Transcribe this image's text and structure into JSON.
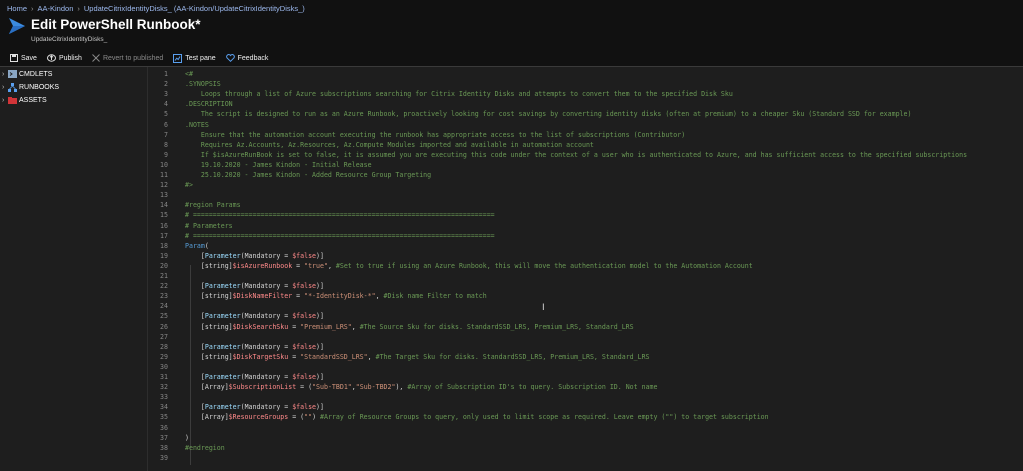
{
  "breadcrumb": [
    "Home",
    "AA-Kindon",
    "UpdateCitrixIdentityDisks_ (AA-Kindon/UpdateCitrixIdentityDisks_)"
  ],
  "title": "Edit PowerShell Runbook*",
  "subtitle": "UpdateCitrixIdentityDisks_",
  "toolbar": {
    "save": "Save",
    "publish": "Publish",
    "revert": "Revert to published",
    "test_pane": "Test pane",
    "feedback": "Feedback"
  },
  "sidebar": {
    "items": [
      {
        "label": "CMDLETS",
        "icon": "cmdlets-icon"
      },
      {
        "label": "RUNBOOKS",
        "icon": "runbooks-icon"
      },
      {
        "label": "ASSETS",
        "icon": "assets-icon"
      }
    ]
  },
  "code_lines": [
    {
      "n": "1",
      "tokens": [
        [
          "c",
          "<#"
        ]
      ]
    },
    {
      "n": "2",
      "tokens": [
        [
          "c",
          ".SYNOPSIS"
        ]
      ]
    },
    {
      "n": "3",
      "tokens": [
        [
          "c",
          "    Loops through a list of Azure subscriptions searching for Citrix Identity Disks and attempts to convert them to the specified Disk Sku"
        ]
      ]
    },
    {
      "n": "4",
      "tokens": [
        [
          "c",
          ".DESCRIPTION"
        ]
      ]
    },
    {
      "n": "5",
      "tokens": [
        [
          "c",
          "    The script is designed to run as an Azure Runbook, proactively looking for cost savings by converting identity disks (often at premium) to a cheaper Sku (Standard SSD for example)"
        ]
      ]
    },
    {
      "n": "6",
      "tokens": [
        [
          "c",
          ".NOTES"
        ]
      ]
    },
    {
      "n": "7",
      "tokens": [
        [
          "c",
          "    Ensure that the automation account executing the runbook has appropriate access to the list of subscriptions (Contributor)"
        ]
      ]
    },
    {
      "n": "8",
      "tokens": [
        [
          "c",
          "    Requires Az.Accounts, Az.Resources, Az.Compute Modules imported and available in automation account"
        ]
      ]
    },
    {
      "n": "9",
      "tokens": [
        [
          "c",
          "    If $isAzureRunBook is set to false, it is assumed you are executing this code under the context of a user who is authenticated to Azure, and has sufficient access to the specified subscriptions"
        ]
      ]
    },
    {
      "n": "10",
      "tokens": [
        [
          "c",
          "    19.10.2020 - James Kindon - Initial Release"
        ]
      ]
    },
    {
      "n": "11",
      "tokens": [
        [
          "c",
          "    25.10.2020 - James Kindon - Added Resource Group Targeting"
        ]
      ]
    },
    {
      "n": "12",
      "tokens": [
        [
          "c",
          "#>"
        ]
      ]
    },
    {
      "n": "13",
      "tokens": []
    },
    {
      "n": "14",
      "tokens": [
        [
          "c",
          "#region Params"
        ]
      ]
    },
    {
      "n": "15",
      "tokens": [
        [
          "c",
          "# ============================================================================"
        ]
      ]
    },
    {
      "n": "16",
      "tokens": [
        [
          "c",
          "# Parameters"
        ]
      ]
    },
    {
      "n": "17",
      "tokens": [
        [
          "c",
          "# ============================================================================"
        ]
      ]
    },
    {
      "n": "18",
      "tokens": [
        [
          "k",
          "Param"
        ],
        [
          "p",
          "("
        ]
      ]
    },
    {
      "n": "19",
      "tokens": [
        [
          "p",
          "    ["
        ],
        [
          "t",
          "Parameter"
        ],
        [
          "p",
          "(Mandatory = "
        ],
        [
          "v",
          "$false"
        ],
        [
          "p",
          ")]"
        ]
      ]
    },
    {
      "n": "20",
      "tokens": [
        [
          "p",
          "    [string]"
        ],
        [
          "v",
          "$isAzureRunbook"
        ],
        [
          "p",
          " = "
        ],
        [
          "s",
          "\"true\""
        ],
        [
          "p",
          ", "
        ],
        [
          "c",
          "#Set to true if using an Azure Runbook, this will move the authentication model to the Automation Account"
        ]
      ]
    },
    {
      "n": "21",
      "tokens": []
    },
    {
      "n": "22",
      "tokens": [
        [
          "p",
          "    ["
        ],
        [
          "t",
          "Parameter"
        ],
        [
          "p",
          "(Mandatory = "
        ],
        [
          "v",
          "$false"
        ],
        [
          "p",
          ")]"
        ]
      ]
    },
    {
      "n": "23",
      "tokens": [
        [
          "p",
          "    [string]"
        ],
        [
          "v",
          "$DiskNameFilter"
        ],
        [
          "p",
          " = "
        ],
        [
          "s",
          "\"*-IdentityDisk-*\""
        ],
        [
          "p",
          ", "
        ],
        [
          "c",
          "#Disk name Filter to match"
        ]
      ]
    },
    {
      "n": "24",
      "tokens": []
    },
    {
      "n": "25",
      "tokens": [
        [
          "p",
          "    ["
        ],
        [
          "t",
          "Parameter"
        ],
        [
          "p",
          "(Mandatory = "
        ],
        [
          "v",
          "$false"
        ],
        [
          "p",
          ")]"
        ]
      ]
    },
    {
      "n": "26",
      "tokens": [
        [
          "p",
          "    [string]"
        ],
        [
          "v",
          "$DiskSearchSku"
        ],
        [
          "p",
          " = "
        ],
        [
          "s",
          "\"Premium_LRS\""
        ],
        [
          "p",
          ", "
        ],
        [
          "c",
          "#The Source Sku for disks. StandardSSD_LRS, Premium_LRS, Standard_LRS"
        ]
      ]
    },
    {
      "n": "27",
      "tokens": []
    },
    {
      "n": "28",
      "tokens": [
        [
          "p",
          "    ["
        ],
        [
          "t",
          "Parameter"
        ],
        [
          "p",
          "(Mandatory = "
        ],
        [
          "v",
          "$false"
        ],
        [
          "p",
          ")]"
        ]
      ]
    },
    {
      "n": "29",
      "tokens": [
        [
          "p",
          "    [string]"
        ],
        [
          "v",
          "$DiskTargetSku"
        ],
        [
          "p",
          " = "
        ],
        [
          "s",
          "\"StandardSSD_LRS\""
        ],
        [
          "p",
          ", "
        ],
        [
          "c",
          "#The Target Sku for disks. StandardSSD_LRS, Premium_LRS, Standard_LRS"
        ]
      ]
    },
    {
      "n": "30",
      "tokens": []
    },
    {
      "n": "31",
      "tokens": [
        [
          "p",
          "    ["
        ],
        [
          "t",
          "Parameter"
        ],
        [
          "p",
          "(Mandatory = "
        ],
        [
          "v",
          "$false"
        ],
        [
          "p",
          ")]"
        ]
      ]
    },
    {
      "n": "32",
      "tokens": [
        [
          "p",
          "    [Array]"
        ],
        [
          "v",
          "$SubscriptionList"
        ],
        [
          "p",
          " = ("
        ],
        [
          "s",
          "\"Sub-TBD1\""
        ],
        [
          "p",
          ","
        ],
        [
          "s",
          "\"Sub-TBD2\""
        ],
        [
          "p",
          "), "
        ],
        [
          "c",
          "#Array of Subscription ID's to query. Subscription ID. Not name"
        ]
      ]
    },
    {
      "n": "33",
      "tokens": []
    },
    {
      "n": "34",
      "tokens": [
        [
          "p",
          "    ["
        ],
        [
          "t",
          "Parameter"
        ],
        [
          "p",
          "(Mandatory = "
        ],
        [
          "v",
          "$false"
        ],
        [
          "p",
          ")]"
        ]
      ]
    },
    {
      "n": "35",
      "tokens": [
        [
          "p",
          "    [Array]"
        ],
        [
          "v",
          "$ResourceGroups"
        ],
        [
          "p",
          " = ("
        ],
        [
          "s",
          "\"\""
        ],
        [
          "p",
          ") "
        ],
        [
          "c",
          "#Array of Resource Groups to query, only used to limit scope as required. Leave empty (\"\") to target subscription"
        ]
      ]
    },
    {
      "n": "36",
      "tokens": []
    },
    {
      "n": "37",
      "tokens": [
        [
          "p",
          ")"
        ]
      ]
    },
    {
      "n": "38",
      "tokens": [
        [
          "c",
          "#endregion"
        ]
      ]
    },
    {
      "n": "39",
      "tokens": []
    }
  ],
  "colors": {
    "comment": "#6a9955",
    "keyword": "#569cd6",
    "variable": "#ff8a8a",
    "string": "#ce9178",
    "link": "#9db9ee"
  }
}
